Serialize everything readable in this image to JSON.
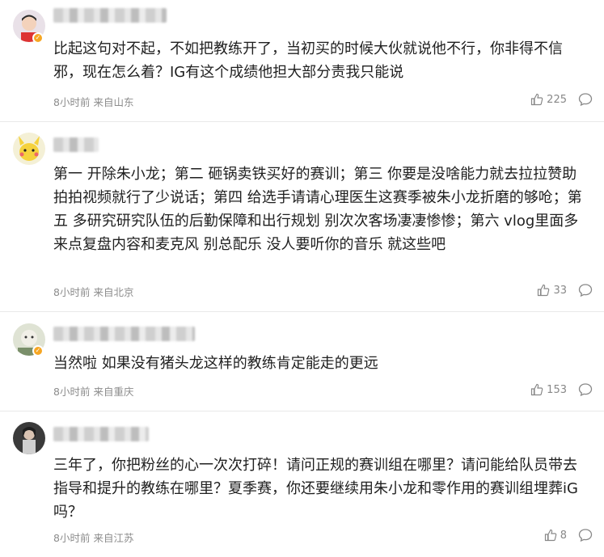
{
  "comments": [
    {
      "text": "比起这句对不起，不如把教练开了，当初买的时候大伙就说他不行，你非得不信邪，现在怎么着？IG有这个成绩他担大部分责我只能说",
      "time": "8小时前",
      "location": "来自山东",
      "likes": "225",
      "verified": true
    },
    {
      "text": "第一 开除朱小龙；第二 砸锅卖铁买好的赛训；第三 你要是没啥能力就去拉拉赞助拍拍视频就行了少说话；第四 给选手请请心理医生这赛季被朱小龙折磨的够呛；第五 多研究研究队伍的后勤保障和出行规划 别次次客场凄凄惨惨；第六 vlog里面多来点复盘内容和麦克风 别总配乐 没人要听你的音乐 就这些吧",
      "time": "8小时前",
      "location": "来自北京",
      "likes": "33",
      "verified": false
    },
    {
      "text": "当然啦 如果没有猪头龙这样的教练肯定能走的更远",
      "time": "8小时前",
      "location": "来自重庆",
      "likes": "153",
      "verified": true
    },
    {
      "text": "三年了，你把粉丝的心一次次打碎！请问正规的赛训组在哪里？请问能给队员带去指导和提升的教练在哪里？夏季赛，你还要继续用朱小龙和零作用的赛训组埋葬iG吗？",
      "time": "8小时前",
      "location": "来自江苏",
      "likes": "8",
      "verified": false
    }
  ],
  "icons": {
    "like": "thumbs-up-icon",
    "reply": "comment-bubble-icon",
    "verified": "verified-badge-icon"
  },
  "colors": {
    "meta": "#8c8c8c",
    "text": "#1f1f1f",
    "badge": "#f6a623"
  }
}
